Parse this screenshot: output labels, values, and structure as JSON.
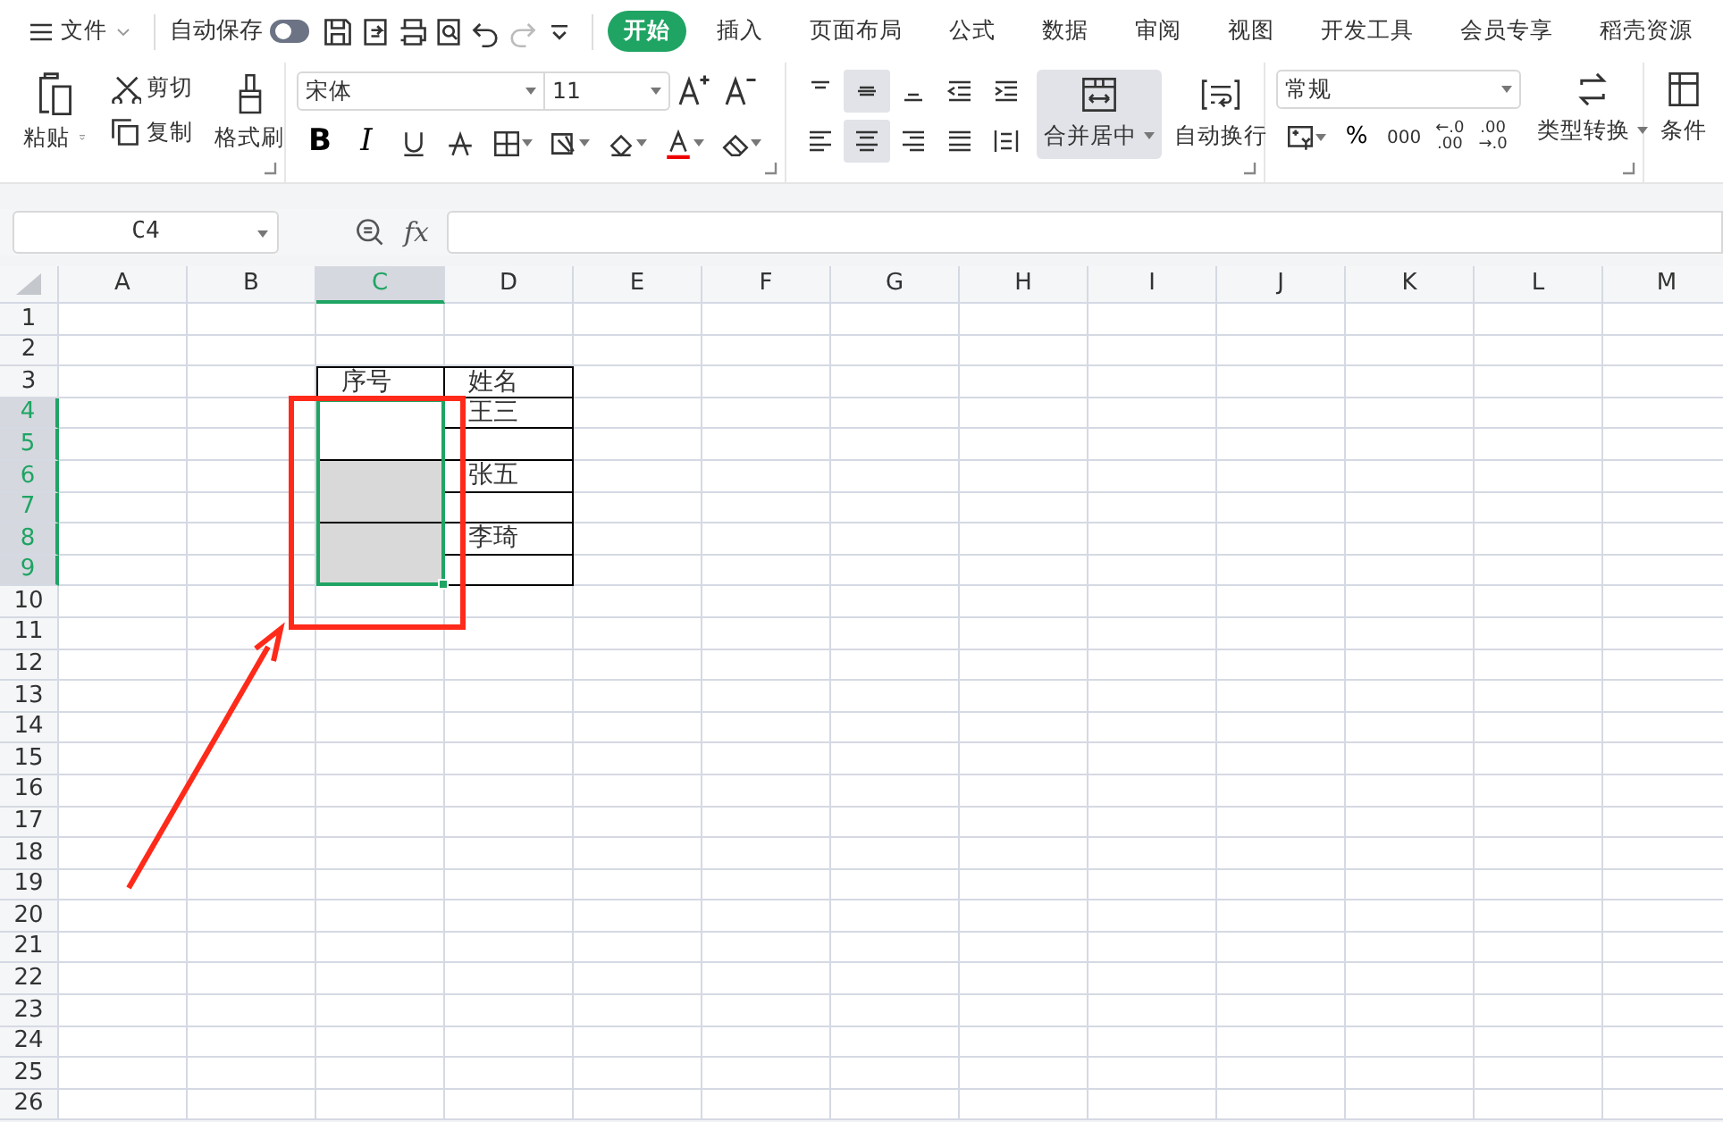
{
  "menu_bar": {
    "file_label": "文件",
    "autosave_label": "自动保存",
    "autosave_on": false,
    "tabs": [
      {
        "label": "开始",
        "selected": true
      },
      {
        "label": "插入",
        "selected": false
      },
      {
        "label": "页面布局",
        "selected": false
      },
      {
        "label": "公式",
        "selected": false
      },
      {
        "label": "数据",
        "selected": false
      },
      {
        "label": "审阅",
        "selected": false
      },
      {
        "label": "视图",
        "selected": false
      },
      {
        "label": "开发工具",
        "selected": false
      },
      {
        "label": "会员专享",
        "selected": false
      },
      {
        "label": "稻壳资源",
        "selected": false
      }
    ]
  },
  "ribbon": {
    "paste": "粘贴",
    "cut": "剪切",
    "copy": "复制",
    "format_painter": "格式刷",
    "font_name": "宋体",
    "font_size": "11",
    "bold": "B",
    "italic": "I",
    "vertical_align": [
      {
        "selected": false
      },
      {
        "selected": true
      },
      {
        "selected": false
      }
    ],
    "horizontal_align": [
      {
        "selected": false
      },
      {
        "selected": true
      },
      {
        "selected": false
      },
      {
        "selected": false
      }
    ],
    "merge_center": {
      "label": "合并居中",
      "selected": true
    },
    "wrap_text": "自动换行",
    "number_format": "常规",
    "percent": "%",
    "thousands": "000",
    "increase_decimal": [
      "←.0",
      ".00"
    ],
    "decrease_decimal": [
      ".00",
      "→.0"
    ],
    "type_convert": "类型转换",
    "conditional": "条件"
  },
  "formula_bar": {
    "cell_ref": "C4",
    "fx": "fx"
  },
  "sheet": {
    "columns": [
      {
        "label": "A",
        "selected": false
      },
      {
        "label": "B",
        "selected": false
      },
      {
        "label": "C",
        "selected": true
      },
      {
        "label": "D",
        "selected": false
      },
      {
        "label": "E",
        "selected": false
      },
      {
        "label": "F",
        "selected": false
      },
      {
        "label": "G",
        "selected": false
      },
      {
        "label": "H",
        "selected": false
      },
      {
        "label": "I",
        "selected": false
      },
      {
        "label": "J",
        "selected": false
      },
      {
        "label": "K",
        "selected": false
      },
      {
        "label": "L",
        "selected": false
      },
      {
        "label": "M",
        "selected": false
      }
    ],
    "rows": [
      {
        "label": "1",
        "selected": false
      },
      {
        "label": "2",
        "selected": false
      },
      {
        "label": "3",
        "selected": false
      },
      {
        "label": "4",
        "selected": true
      },
      {
        "label": "5",
        "selected": true
      },
      {
        "label": "6",
        "selected": true
      },
      {
        "label": "7",
        "selected": true
      },
      {
        "label": "8",
        "selected": true
      },
      {
        "label": "9",
        "selected": true
      },
      {
        "label": "10",
        "selected": false
      },
      {
        "label": "11",
        "selected": false
      },
      {
        "label": "12",
        "selected": false
      },
      {
        "label": "13",
        "selected": false
      },
      {
        "label": "14",
        "selected": false
      },
      {
        "label": "15",
        "selected": false
      },
      {
        "label": "16",
        "selected": false
      },
      {
        "label": "17",
        "selected": false
      },
      {
        "label": "18",
        "selected": false
      },
      {
        "label": "19",
        "selected": false
      },
      {
        "label": "20",
        "selected": false
      },
      {
        "label": "21",
        "selected": false
      },
      {
        "label": "22",
        "selected": false
      },
      {
        "label": "23",
        "selected": false
      },
      {
        "label": "24",
        "selected": false
      },
      {
        "label": "25",
        "selected": false
      },
      {
        "label": "26",
        "selected": false
      }
    ],
    "table": {
      "header": [
        "序号",
        "姓名"
      ],
      "records": [
        {
          "name": "王三",
          "active": true
        },
        {
          "name": "张五",
          "active": false
        },
        {
          "name": "李琦",
          "active": false
        }
      ]
    }
  }
}
